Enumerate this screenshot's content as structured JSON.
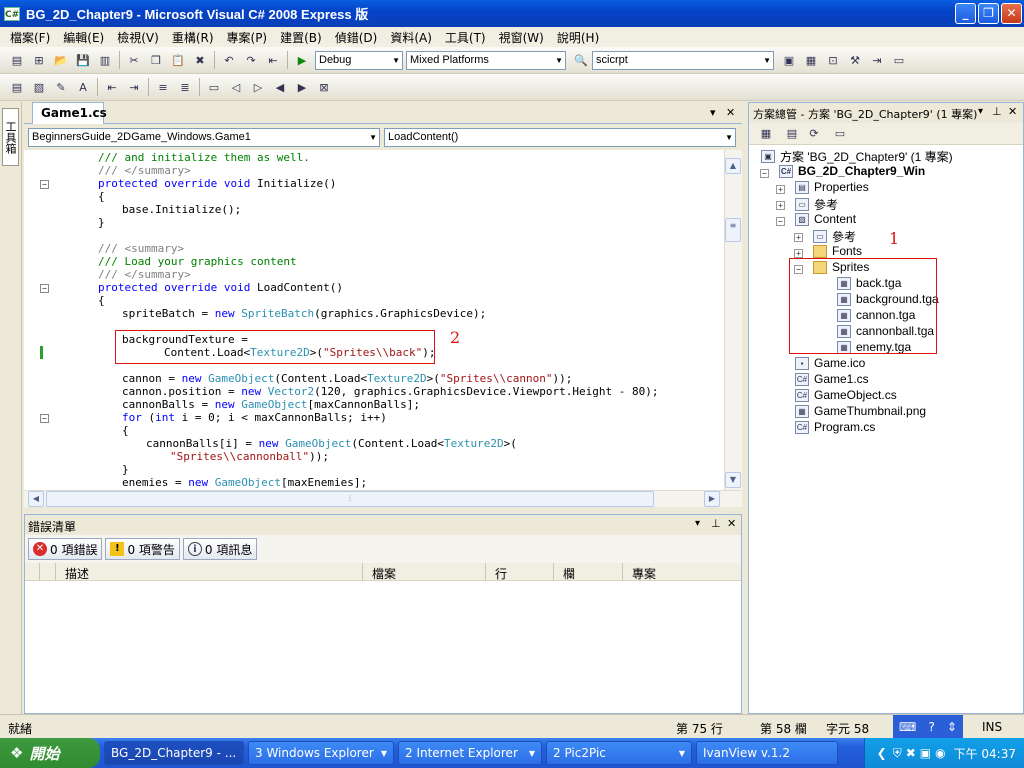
{
  "window": {
    "title": "BG_2D_Chapter9 - Microsoft Visual C# 2008 Express 版"
  },
  "menu": [
    "檔案(F)",
    "編輯(E)",
    "檢視(V)",
    "重構(R)",
    "專案(P)",
    "建置(B)",
    "偵錯(D)",
    "資料(A)",
    "工具(T)",
    "視窗(W)",
    "說明(H)"
  ],
  "toolbar": {
    "config": "Debug",
    "platform": "Mixed Platforms",
    "find": "scicrpt"
  },
  "toolbox_label": "工具箱",
  "editor": {
    "tab": "Game1.cs",
    "type_combo": "BeginnersGuide_2DGame_Windows.Game1",
    "member_combo": "LoadContent()"
  },
  "code": {
    "l0": "/// and initialize them as well.",
    "l1": "/// </summary>",
    "l2a": "protected override void",
    "l2b": " Initialize()",
    "l3": "{",
    "l4": "base.Initialize();",
    "l5": "}",
    "l6": "/// <summary>",
    "l7": "/// Load your graphics content",
    "l8": "/// </summary>",
    "l9a": "protected override void",
    "l9b": " LoadContent()",
    "l10": "{",
    "l11a": "spriteBatch = ",
    "l11b": "new",
    "l11c": " SpriteBatch",
    "l11d": "(graphics.GraphicsDevice);",
    "l12": "backgroundTexture =",
    "l13a": "Content.Load<",
    "l13b": "Texture2D",
    "l13c": ">(",
    "l13d": "\"Sprites\\\\back\"",
    "l13e": ");",
    "l14a": "cannon = ",
    "l14b": "new",
    "l14c": " GameObject",
    "l14d": "(Content.Load<",
    "l14e": "Texture2D",
    "l14f": ">(",
    "l14g": "\"Sprites\\\\cannon\"",
    "l14h": "));",
    "l15a": "cannon.position = ",
    "l15b": "new",
    "l15c": " Vector2",
    "l15d": "(120, graphics.GraphicsDevice.Viewport.Height - 80);",
    "l16a": "cannonBalls = ",
    "l16b": "new",
    "l16c": " GameObject",
    "l16d": "[maxCannonBalls];",
    "l17a": "for",
    "l17b": " (",
    "l17c": "int",
    "l17d": " i = 0; i < maxCannonBalls; i++)",
    "l18": "{",
    "l19a": "cannonBalls[i] = ",
    "l19b": "new",
    "l19c": " GameObject",
    "l19d": "(Content.Load<",
    "l19e": "Texture2D",
    "l19f": ">(",
    "l20a": "\"Sprites\\\\cannonball\"",
    "l20b": "));",
    "l21": "}",
    "l22a": "enemies = ",
    "l22b": "new",
    "l22c": " GameObject",
    "l22d": "[maxEnemies];"
  },
  "annotations": {
    "one": "1",
    "two": "2"
  },
  "error_list": {
    "title": "錯誤清單",
    "errors_btn": "0 項錯誤",
    "warnings_btn": "0 項警告",
    "messages_btn": "0 項訊息",
    "columns": [
      "描述",
      "檔案",
      "行",
      "欄",
      "專案"
    ]
  },
  "solution": {
    "title": "方案總管 - 方案 'BG_2D_Chapter9' (1 專案)",
    "root": "方案 'BG_2D_Chapter9' (1 專案)",
    "project": "BG_2D_Chapter9_Win",
    "properties": "Properties",
    "refs": "參考",
    "content": "Content",
    "content_refs": "參考",
    "fonts": "Fonts",
    "sprites": "Sprites",
    "sprite_files": [
      "back.tga",
      "background.tga",
      "cannon.tga",
      "cannonball.tga",
      "enemy.tga"
    ],
    "files": [
      "Game.ico",
      "Game1.cs",
      "GameObject.cs",
      "GameThumbnail.png",
      "Program.cs"
    ]
  },
  "status": {
    "ready": "就緒",
    "line": "第 75 行",
    "col": "第 58 欄",
    "char": "字元 58",
    "ins": "INS"
  },
  "taskbar": {
    "start": "開始",
    "tasks": [
      "BG_2D_Chapter9 - ...",
      "3 Windows Explorer",
      "2 Internet Explorer",
      "2 Pic2Pic",
      "IvanView v.1.2"
    ],
    "clock": "下午 04:37"
  }
}
